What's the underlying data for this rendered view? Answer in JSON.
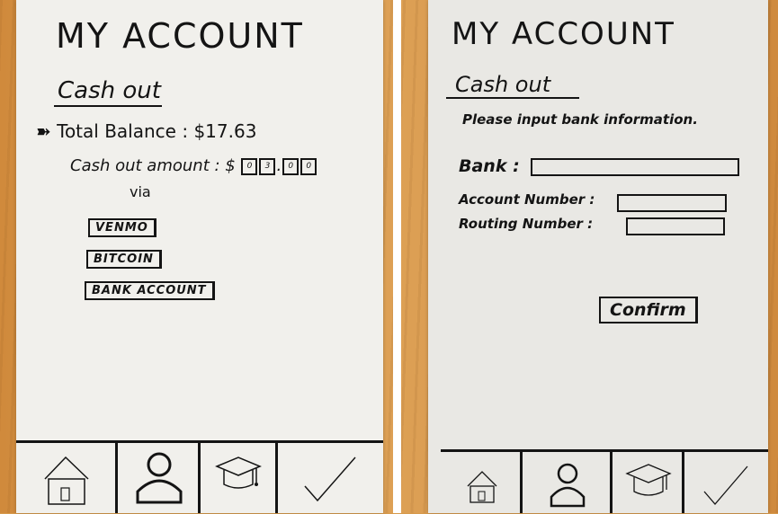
{
  "left_screen": {
    "title": "MY ACCOUNT",
    "section": "Cash out",
    "total_balance_label": "Total Balance",
    "total_balance_value": "$17.63",
    "cashout_label": "Cash out amount :",
    "currency": "$",
    "amount_digits": [
      "0",
      "3",
      ".",
      "0",
      "0"
    ],
    "via_label": "via",
    "options": [
      "VENMO",
      "BITCOIN",
      "BANK ACCOUNT"
    ]
  },
  "right_screen": {
    "title": "MY ACCOUNT",
    "section": "Cash out",
    "instruction": "Please input bank information.",
    "bank_label": "Bank :",
    "account_label": "Account Number :",
    "routing_label": "Routing Number :",
    "confirm_label": "Confirm"
  },
  "nav": {
    "items": [
      "home-icon",
      "profile-icon",
      "graduation-cap-icon",
      "checkmark-icon"
    ]
  }
}
